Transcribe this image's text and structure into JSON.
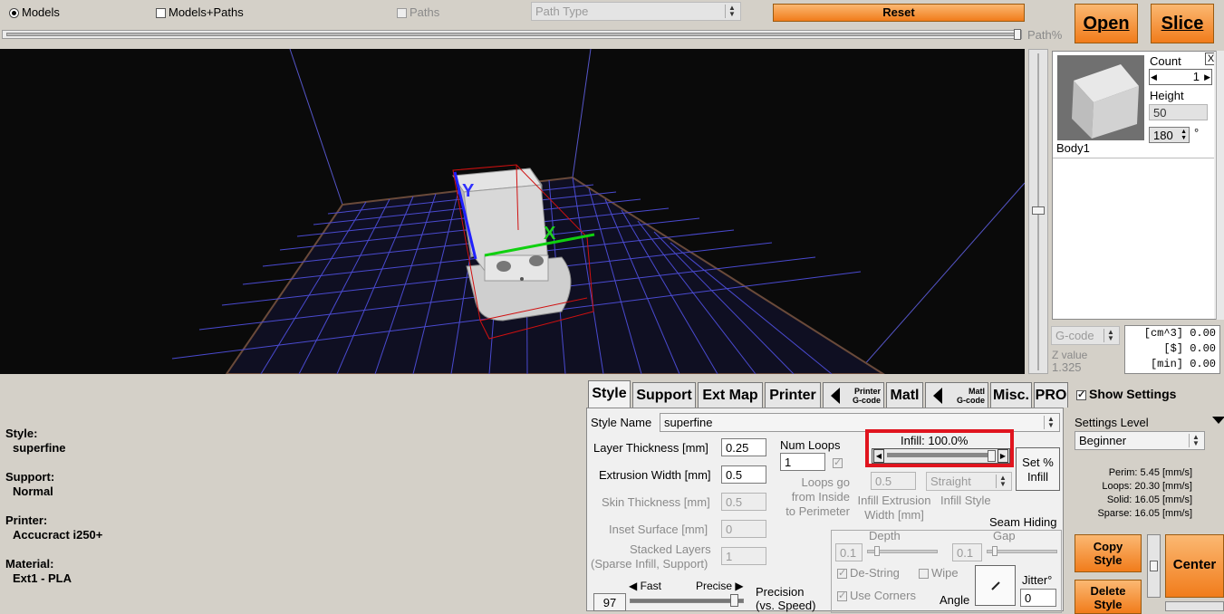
{
  "toolbar": {
    "view_models": "Models",
    "view_models_paths": "Models+Paths",
    "view_paths": "Paths",
    "path_type": "Path Type",
    "reset": "Reset",
    "path_pct": "Path%",
    "open": "Open",
    "slice": "Slice"
  },
  "axes": {
    "y": "Y",
    "x": "X"
  },
  "model": {
    "name": "Body1",
    "count_label": "Count",
    "count": "1",
    "close": "X",
    "height_label": "Height",
    "height": "50",
    "rotation": "180",
    "degree": "°"
  },
  "stats": {
    "gcode_combo": "G-code",
    "z_label": "Z value",
    "z_value": "1.325",
    "lines": [
      "[cm^3] 0.00",
      "[$] 0.00",
      "[min] 0.00"
    ]
  },
  "summary": [
    {
      "label": "Style:",
      "value": "superfine"
    },
    {
      "label": "Support:",
      "value": "Normal"
    },
    {
      "label": "Printer:",
      "value": "Accucract i250+"
    },
    {
      "label": "Material:",
      "value": "Ext1 - PLA"
    }
  ],
  "tabs": {
    "style": "Style",
    "support": "Support",
    "ext_map": "Ext Map",
    "printer": "Printer",
    "printer_gcode_1": "Printer",
    "printer_gcode_2": "G-code",
    "matl": "Matl",
    "matl_gcode_1": "Matl",
    "matl_gcode_2": "G-code",
    "misc": "Misc.",
    "pro": "PRO"
  },
  "style": {
    "name_label": "Style Name",
    "name": "superfine",
    "layer_thickness_label": "Layer Thickness [mm]",
    "layer_thickness": "0.25",
    "extrusion_width_label": "Extrusion Width [mm]",
    "extrusion_width": "0.5",
    "skin_thickness_label": "Skin Thickness [mm]",
    "skin_thickness": "0.5",
    "inset_surface_label": "Inset  Surface [mm]",
    "inset_surface": "0",
    "stacked_layers_label_1": "Stacked Layers",
    "stacked_layers_label_2": "(Sparse Infill, Support)",
    "stacked_layers": "1",
    "num_loops_label": "Num Loops",
    "num_loops": "1",
    "loops_inside_1": "Loops go",
    "loops_inside_2": "from Inside",
    "loops_inside_3": "to Perimeter",
    "infill_label": "Infill: 100.0%",
    "infill_fraction": 1.0,
    "set_infill_1": "Set %",
    "set_infill_2": "Infill",
    "infill_width": "0.5",
    "infill_width_label_1": "Infill Extrusion",
    "infill_width_label_2": "Width [mm]",
    "infill_style": "Straight",
    "infill_style_label": "Infill Style",
    "seam_label": "Seam Hiding",
    "depth_label": "Depth",
    "depth": "0.1",
    "gap_label": "Gap",
    "gap": "0.1",
    "destring": "De-String",
    "wipe": "Wipe",
    "use_corners": "Use Corners",
    "angle_label": "Angle",
    "jitter_label": "Jitter°",
    "jitter": "0",
    "fast": "Fast",
    "precise": "Precise",
    "precision_value": "97",
    "precision_label_1": "Precision",
    "precision_label_2": "(vs. Speed)"
  },
  "settings": {
    "show_settings": "Show Settings",
    "level_label": "Settings Level",
    "level": "Beginner",
    "speeds": [
      "Perim:  5.45 [mm/s]",
      "Loops:  20.30 [mm/s]",
      "Solid:  16.05 [mm/s]",
      "Sparse: 16.05 [mm/s]"
    ],
    "copy_style_1": "Copy",
    "copy_style_2": "Style",
    "delete_style_1": "Delete",
    "delete_style_2": "Style",
    "center": "Center"
  },
  "colors": {
    "accent_orange": "#f17c1b",
    "highlight_red": "#e0141e",
    "viewport_bg": "#0a0a0a",
    "grid": "#5a5ad8"
  }
}
